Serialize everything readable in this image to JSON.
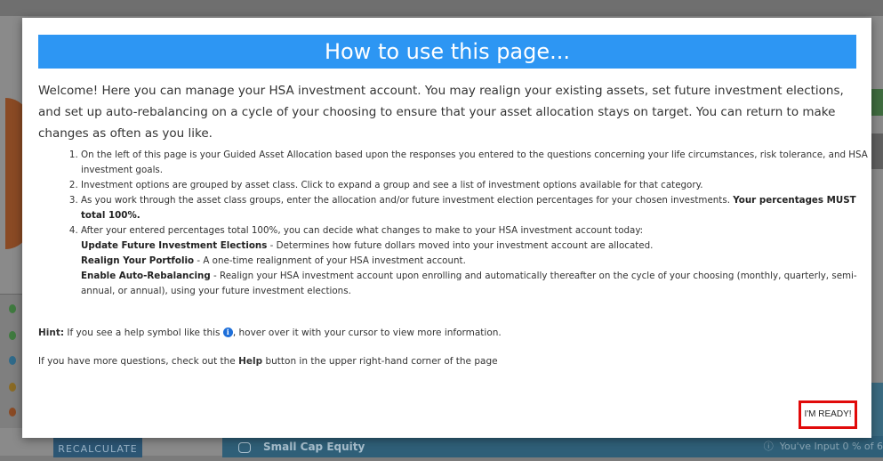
{
  "modal": {
    "title": "How to use this page...",
    "intro": "Welcome! Here you can manage your HSA investment account. You may realign your existing assets, set future investment elections, and set up auto-rebalancing on a cycle of your choosing to ensure that your asset allocation stays on target. You can return to make changes as often as you like.",
    "steps": [
      {
        "text": "On the left of this page is your Guided Asset Allocation based upon the responses you entered to the questions concerning your life circumstances, risk tolerance, and HSA investment goals."
      },
      {
        "text": "Investment options are grouped by asset class. Click to expand a group and see a list of investment options available for that category."
      },
      {
        "text": "As you work through the asset class groups, enter the allocation and/or future investment election percentages for your chosen investments.",
        "bold": "Your percentages MUST total 100%."
      },
      {
        "text": "After your entered percentages total 100%, you can decide what changes to make to your HSA investment account today:"
      }
    ],
    "options": [
      {
        "label": "Update Future Investment Elections",
        "desc": " - Determines how future dollars moved into your investment account are allocated."
      },
      {
        "label": "Realign Your Portfolio",
        "desc": " - A one-time realignment of your HSA investment account."
      },
      {
        "label": "Enable Auto-Rebalancing",
        "desc": " - Realign your HSA investment account upon enrolling and automatically thereafter on the cycle of your choosing (monthly, quarterly, semi-annual, or annual), using your future investment elections."
      }
    ],
    "hint_label": "Hint:",
    "hint_before": " If you see a help symbol like this ",
    "hint_icon": "info-icon",
    "hint_after": ", hover over it with your cursor to view more information.",
    "more_before": "If you have more questions, check out the ",
    "more_bold": "Help",
    "more_after": " button in the upper right-hand corner of the page",
    "ready_label": "I'M READY!"
  },
  "background": {
    "recalc_label": "RECALCULATE",
    "strip_label": "Small Cap Equity",
    "strip_right": "You've Input 0 % of 6"
  },
  "colors": {
    "header": "#2d96f3",
    "highlight": "#e10a0a",
    "info_icon": "#1e6fd9"
  }
}
